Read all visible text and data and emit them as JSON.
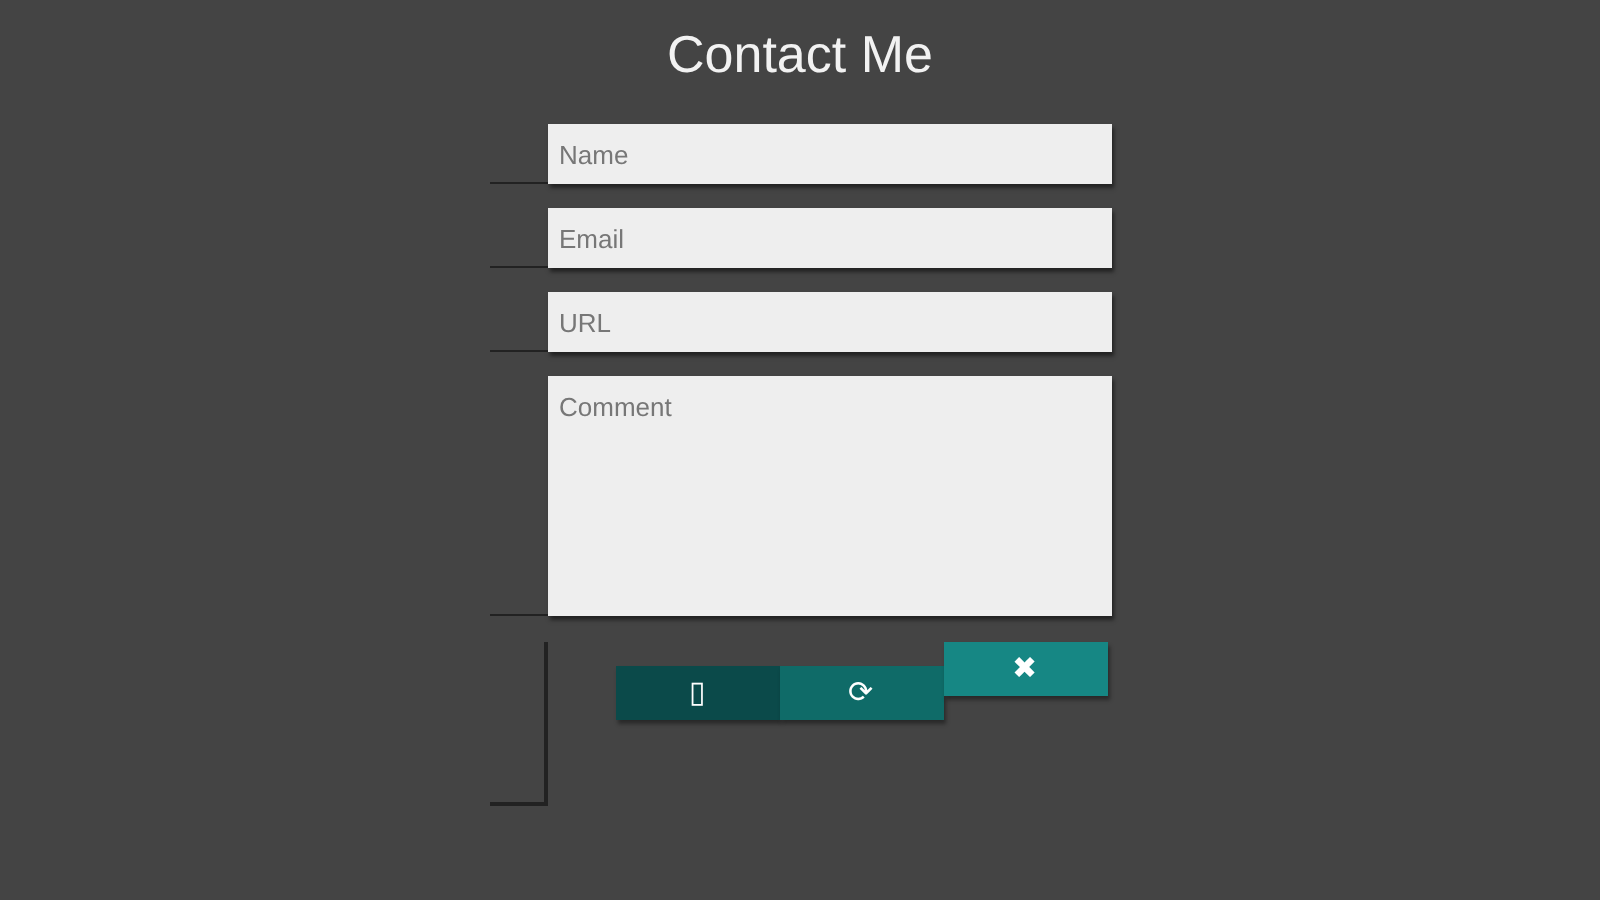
{
  "title": "Contact Me",
  "fields": [
    {
      "kind": "line",
      "placeholder": "Name"
    },
    {
      "kind": "line",
      "placeholder": "Email"
    },
    {
      "kind": "line",
      "placeholder": "URL"
    },
    {
      "kind": "area",
      "placeholder": "Comment"
    }
  ],
  "buttons": [
    {
      "label": "▯",
      "color": "#0b4a4a"
    },
    {
      "label": "⟳",
      "color": "#0f6b68"
    },
    {
      "label": "✖",
      "color": "#168784"
    }
  ]
}
